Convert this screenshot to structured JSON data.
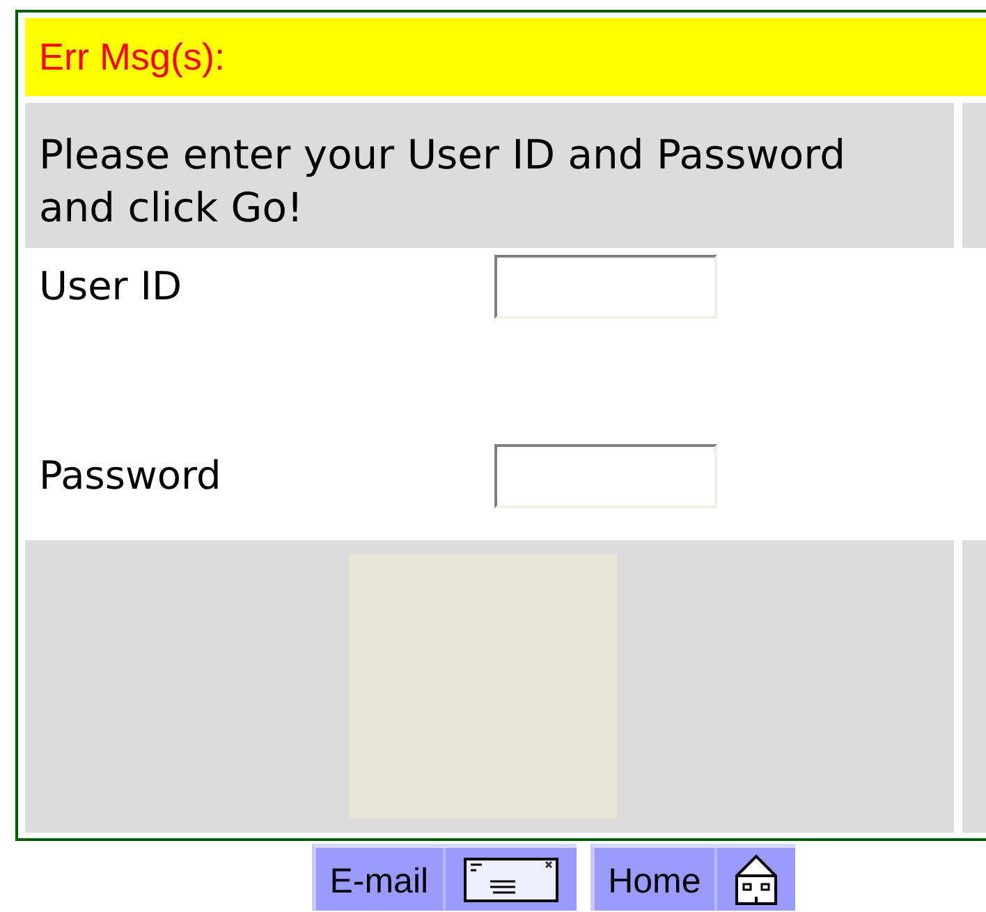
{
  "error_bar": {
    "label": "Err Msg(s):"
  },
  "instructions": "Please enter your User ID and Password and click Go!",
  "fields": [
    {
      "label": "User ID"
    },
    {
      "label": "Password"
    }
  ],
  "footer_buttons": [
    {
      "label": "E-mail",
      "kind": "email"
    },
    {
      "label": "Home",
      "kind": "home"
    }
  ]
}
